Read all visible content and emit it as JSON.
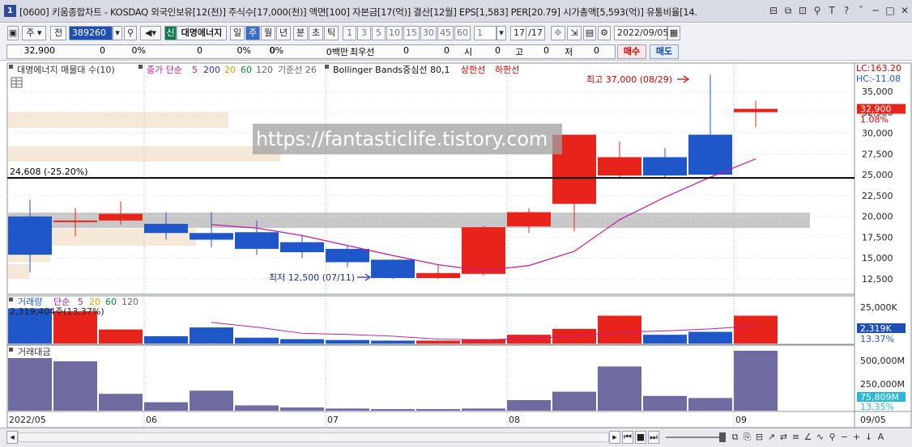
{
  "window": {
    "app_icon": "1",
    "title": "[0600] 키움종합차트 - KOSDAQ 외국인보유[12(천)] 주식수[17,000(천)] 액면[100] 자본금[17(억)] 결산[12월] EPS[1,583] PER[20.79] 시가총액[5,593(억)] 유통비율[14.",
    "tools": [
      "⊟",
      "⧉",
      "⊡",
      "⚲",
      "T",
      "?",
      "ˇ",
      "─",
      "□",
      "✕"
    ]
  },
  "toolbar": {
    "type_label": "주",
    "prev_label": "전",
    "code_value": "389260",
    "search_icon": "magnifier-icon",
    "stock_badge": "신",
    "stock_name": "대명에너지",
    "periods": [
      "일",
      "주",
      "월",
      "년",
      "분",
      "초",
      "틱"
    ],
    "period_selected": "주",
    "intervals": [
      "1",
      "3",
      "5",
      "10",
      "15",
      "30",
      "45",
      "60"
    ],
    "unit_value": "1",
    "count_value": "17",
    "count_total": "/17",
    "date_value": "2022/09/05"
  },
  "quote_bar": {
    "price": "32,900",
    "v1": "0",
    "p1": "0%",
    "v2": "0",
    "p2": "0%",
    "v3": "0",
    "p3": "0%",
    "amount": "0백만",
    "best_label": "최우선",
    "best1": "0",
    "best2": "0",
    "open_label": "시",
    "open": "0",
    "high_label": "고",
    "high": "0",
    "low_label": "저",
    "low": "0",
    "buy_label": "매수",
    "sell_label": "매도"
  },
  "main_panel": {
    "legend_stock": "대명에너지 매물대 수(10)",
    "legend_ma": "종가 단순",
    "ma_periods": [
      "5",
      "200",
      "20",
      "60",
      "120"
    ],
    "ma_colors": [
      "#c0008a",
      "#2a34b0",
      "#d4a000",
      "#0a8a30",
      "#666666"
    ],
    "legend_base": "기준선 26",
    "legend_bb": "Bollinger Bands중심선 80,1",
    "legend_upper": "상한선",
    "legend_lower": "하한선",
    "lc_label": "LC:163.20",
    "hc_label": "HC:-11.08",
    "high_note": "최고 37,000 (08/29)",
    "low_note": "최저 12,500 (07/11)",
    "line_label": "24,608 (-25.20%)",
    "price_current": "32,900",
    "price_change": "1.08%",
    "y_ticks": [
      "35,000",
      "32,500",
      "30,000",
      "27,500",
      "25,000",
      "22,500",
      "20,000",
      "17,500",
      "15,000",
      "12,500"
    ]
  },
  "volume_panel": {
    "legend_title": "거래량",
    "legend_ma": "단순",
    "ma_periods": [
      "5",
      "20",
      "60",
      "120"
    ],
    "first_value": "2,319,404주(13.37%)",
    "y_ticks": [
      "25,000K"
    ],
    "current": "2,319K",
    "current_pct": "13.37%"
  },
  "amount_panel": {
    "legend_title": "거래대금",
    "y_ticks": [
      "500,000M",
      "250,000M"
    ],
    "current": "75,809M",
    "current_pct": "13.35%"
  },
  "x_axis": {
    "labels": [
      "2022/05",
      "06",
      "07",
      "08",
      "09"
    ],
    "right_label": "09/05"
  },
  "watermark": "https://fantasticlife.tistory.com",
  "colors": {
    "up": "#e8231b",
    "down": "#1f56c8",
    "ma5": "#c8189c",
    "volume_bar": "#6f6aa0",
    "accent_label_bg": "#1e50b4"
  },
  "chart_data": {
    "type": "candlestick",
    "x": [
      "05/16",
      "05/23",
      "05/30",
      "06/06",
      "06/13",
      "06/20",
      "06/27",
      "07/04",
      "07/11",
      "07/18",
      "07/25",
      "08/01",
      "08/08",
      "08/15",
      "08/22",
      "08/29",
      "09/05"
    ],
    "open": [
      20000,
      19500,
      19500,
      19100,
      18000,
      18100,
      16900,
      16100,
      14800,
      12600,
      13100,
      18800,
      21500,
      24900,
      27100,
      29800,
      32500
    ],
    "close": [
      15400,
      19500,
      20300,
      18000,
      17200,
      16100,
      15700,
      14500,
      12600,
      13200,
      18700,
      20500,
      29800,
      27100,
      24900,
      25000,
      32900
    ],
    "high": [
      22000,
      21000,
      21800,
      20500,
      20500,
      19500,
      17800,
      16500,
      14800,
      14200,
      18900,
      21000,
      29800,
      29000,
      28200,
      37000,
      33900
    ],
    "low": [
      13300,
      17600,
      19000,
      17200,
      16300,
      15400,
      15000,
      13900,
      12500,
      12500,
      12900,
      18000,
      18200,
      24600,
      24700,
      25200,
      30700
    ],
    "volume_k": [
      12000,
      11000,
      4800,
      2500,
      5500,
      2000,
      1500,
      1200,
      1000,
      1000,
      1500,
      3000,
      5000,
      9500,
      3000,
      4000,
      9500,
      2319
    ],
    "amount_m": [
      500000,
      470000,
      160000,
      80000,
      190000,
      50000,
      30000,
      20000,
      15000,
      15000,
      20000,
      100000,
      180000,
      420000,
      140000,
      120000,
      570000,
      75809
    ],
    "ma5": [
      null,
      null,
      null,
      null,
      19000,
      18600,
      17700,
      16500,
      15300,
      14200,
      13500,
      14100,
      15800,
      19600,
      22300,
      24700,
      26900
    ],
    "horizontal_line": 24608
  }
}
